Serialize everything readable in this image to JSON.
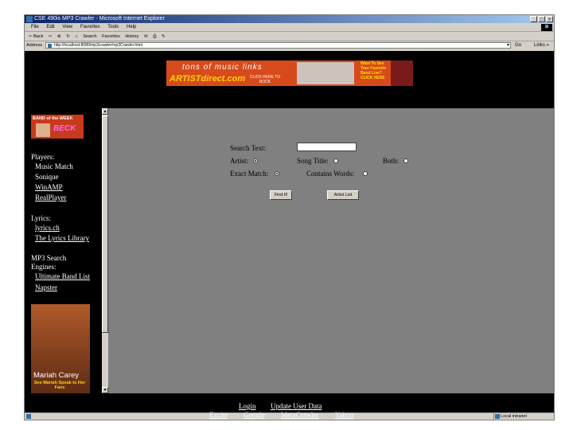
{
  "window": {
    "title": "CSE 490is MP3 Crawler - Microsoft Internet Explorer",
    "controls": [
      "_",
      "□",
      "×"
    ]
  },
  "menu": [
    "File",
    "Edit",
    "View",
    "Favorites",
    "Tools",
    "Help"
  ],
  "toolbar": {
    "back": "⇦ Back",
    "forward": "⇨",
    "stop": "⊗",
    "refresh": "↻",
    "home": "⌂",
    "search": "Search",
    "favorites": "Favorites",
    "history": "History",
    "mail": "✉",
    "print": "⎙",
    "edit": "✎"
  },
  "address": {
    "label": "Address",
    "url": "http://localhost:8080/mp3crawler/mp3Crawler.html",
    "go": "Go",
    "links": "Links »"
  },
  "banner": {
    "line1": "tons of music links",
    "brand": "ARTISTdirect.com",
    "cta": "CLICK HERE TO ROCK",
    "promo": "Want To See Your Favorite Band Live? CLICK HERE"
  },
  "sidebar": {
    "band_week": "BAND of the WEEK",
    "band_name": "BECK",
    "players_heading": "Players:",
    "players": [
      "Music Match",
      "Sonique",
      "WinAMP",
      "RealPlayer"
    ],
    "lyrics_heading": "Lyrics:",
    "lyrics": [
      "lyrics.ch",
      "The Lyrics Library"
    ],
    "engines_heading_1": "MP3 Search",
    "engines_heading_2": "Engines:",
    "engines": [
      "Ultimate Band List",
      "Napster"
    ],
    "ad_title": "Mariah Carey",
    "ad_sub": "See Mariah Speak to Her Fans"
  },
  "search": {
    "search_text_label": "Search Text:",
    "search_value": "",
    "artist_label": "Artist:",
    "song_title_label": "Song Title:",
    "both_label": "Both:",
    "exact_match_label": "Exact Match:",
    "contains_words_label": "Contains Words:",
    "find_button": "Find It!",
    "artist_list_button": "Artist List"
  },
  "footer": {
    "login": "Login",
    "update": "Update User Data",
    "engines": [
      "Excite",
      "Google",
      "MetaCrawler",
      "Yahoo"
    ]
  },
  "status": {
    "left": "",
    "zone": "Local intranet"
  }
}
